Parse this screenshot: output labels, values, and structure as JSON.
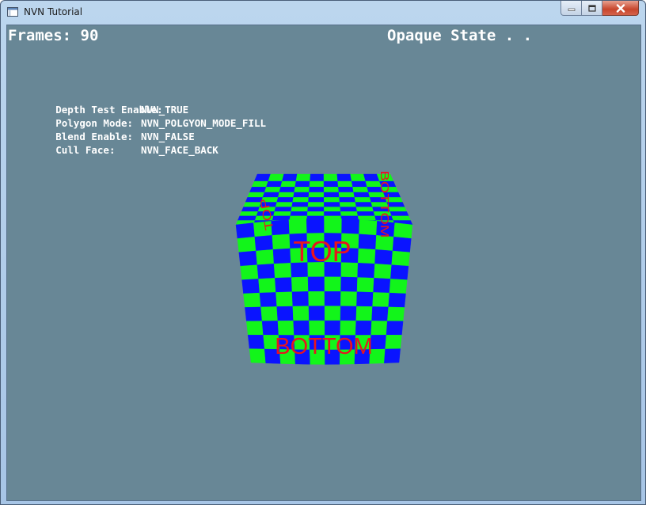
{
  "window": {
    "title": "NVN Tutorial",
    "icon": "app-window-icon",
    "controls": {
      "minimize": "minimize-icon",
      "maximize": "maximize-icon",
      "close": "close-icon"
    }
  },
  "hud": {
    "frames": "Frames: 90",
    "state": "Opaque State . .",
    "settings": [
      {
        "label": "Depth Test Enable:",
        "value": "NVN_TRUE"
      },
      {
        "label": "Polygon Mode:",
        "value": "NVN_POLGYON_MODE_FILL"
      },
      {
        "label": "Blend Enable:",
        "value": "NVN_FALSE"
      },
      {
        "label": "Cull Face:",
        "value": "NVN_FACE_BACK"
      }
    ]
  },
  "scene": {
    "clear_color": "#688796",
    "checker_colors": [
      "#0a14ff",
      "#12f51a"
    ],
    "text_color": "#e8141e",
    "front_face_labels": [
      "TOP",
      "BOTTOM"
    ],
    "top_face_labels": [
      "TOP",
      "BOTTOM"
    ]
  }
}
